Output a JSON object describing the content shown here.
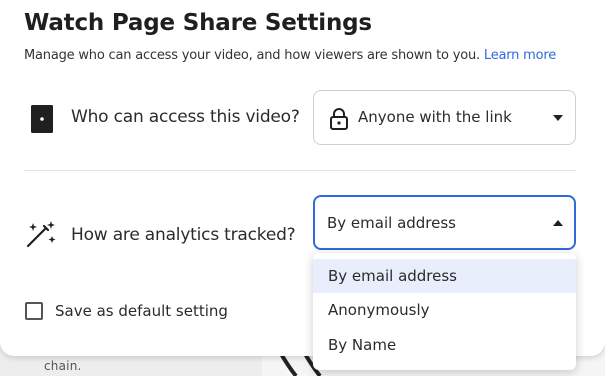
{
  "dialog": {
    "title": "Watch Page Share Settings",
    "subtitle": "Manage who can access your video, and how viewers are shown to you.",
    "learn_more": "Learn more"
  },
  "access": {
    "label": "Who can access this video?",
    "icon": "door-icon",
    "select_icon": "lock-icon",
    "value": "Anyone with the link"
  },
  "analytics": {
    "label": "How are analytics tracked?",
    "icon": "sparkle-wand-icon",
    "value": "By email address",
    "options": [
      "By email address",
      "Anonymously",
      "By Name"
    ],
    "selected_index": 0
  },
  "default_setting": {
    "label": "Save as default setting",
    "checked": false
  },
  "background": {
    "text": "Continue this to create the chain."
  },
  "colors": {
    "accent": "#2f6bdc",
    "selected_option_bg": "#e8eefb"
  }
}
